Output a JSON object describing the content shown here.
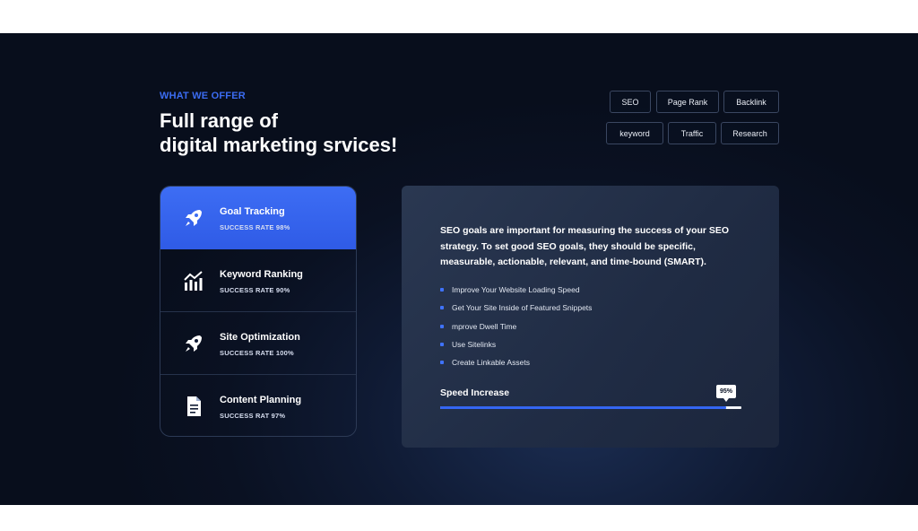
{
  "header": {
    "eyebrow": "WHAT WE OFFER",
    "title_line1": "Full range of",
    "title_line2": "digital marketing srvices!"
  },
  "tags": [
    "SEO",
    "Page Rank",
    "Backlink",
    "keyword",
    "Traffic",
    "Research"
  ],
  "services": [
    {
      "name": "Goal Tracking",
      "rate": "SUCCESS RATE 98%",
      "icon": "rocket-icon",
      "active": true
    },
    {
      "name": "Keyword Ranking",
      "rate": "SUCCESS RATE 90%",
      "icon": "chart-icon",
      "active": false
    },
    {
      "name": "Site Optimization",
      "rate": "SUCCESS RATE 100%",
      "icon": "rocket-icon",
      "active": false
    },
    {
      "name": "Content Planning",
      "rate": "SUCCESS RAT 97%",
      "icon": "document-icon",
      "active": false
    }
  ],
  "panel": {
    "intro": "SEO goals are important for measuring the success of your SEO strategy. To set good SEO goals, they should be specific, measurable, actionable, relevant, and time-bound (SMART).",
    "items": [
      "Improve Your Website Loading Speed",
      "Get Your Site Inside of Featured Snippets",
      "mprove Dwell Time",
      "Use Sitelinks",
      "Create Linkable Assets"
    ],
    "progress_label": "Speed Increase",
    "progress_value": "95%",
    "progress_percent": 95
  },
  "colors": {
    "accent": "#3466f2",
    "eyebrow": "#3b6cf2",
    "background": "#0a1122"
  }
}
